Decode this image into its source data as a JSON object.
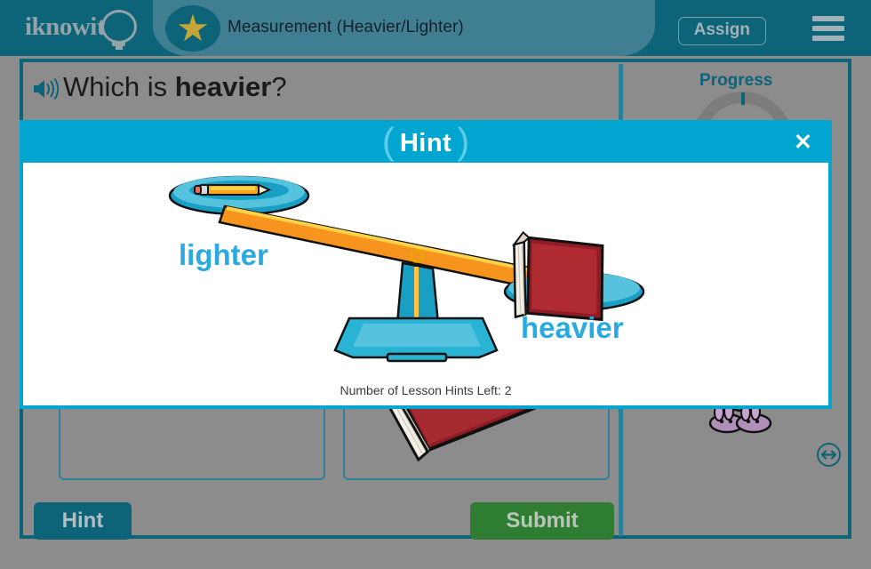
{
  "header": {
    "logo_text": "iknowit",
    "logo_icon": "lightbulb-icon",
    "star_icon": "star-icon",
    "star_glyph": "★",
    "lesson_title": "Measurement (Heavier/Lighter)",
    "assign_label": "Assign",
    "menu_icon": "hamburger-menu-icon",
    "bar_color": "#0d6378",
    "lobe_color": "#3f7f91",
    "star_color": "#c4a53a"
  },
  "question": {
    "speaker_icon": "speaker-audio-icon",
    "prefix": "Which is ",
    "emphasis": "heavier",
    "suffix": "?"
  },
  "options": [
    {
      "name": "option-a",
      "image": ""
    },
    {
      "name": "option-b",
      "image": "red-book-image"
    }
  ],
  "progress": {
    "label": "Progress",
    "ring_color": "#7c7c7c",
    "tick_color": "#0d6378",
    "mascot_icon": "dinosaur-mascot-in-bunny-slippers",
    "resize_icon": "resize-horizontal-icon"
  },
  "footer_buttons": {
    "hint_label": "Hint",
    "hint_color": "#0d6378",
    "submit_label": "Submit",
    "submit_color": "#2e7d32"
  },
  "modal": {
    "title": "Hint",
    "paren_left": "(",
    "paren_right": ")",
    "close_icon": "close-x-icon",
    "close_glyph": "✕",
    "header_color": "#00a5d0",
    "illustration": {
      "name": "balance-scale-illustration",
      "left_item": "pencil",
      "right_item": "red-book",
      "left_label": "lighter",
      "right_label": "heavier",
      "label_color": "#29abe2",
      "beam_color": "#f7941e",
      "pan_color": "#29abe2",
      "base_color": "#29abe2"
    },
    "footer_text": "Number of Lesson Hints Left: 2"
  }
}
